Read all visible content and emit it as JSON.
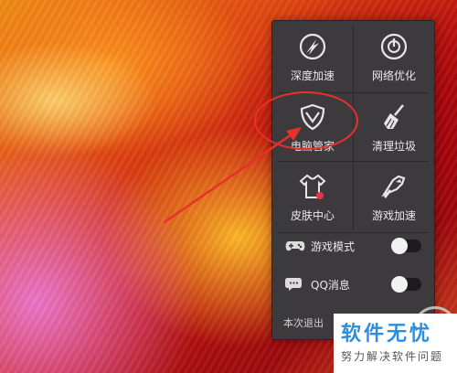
{
  "panel": {
    "tiles": [
      {
        "label": "深度加速",
        "icon": "speed-boost-icon"
      },
      {
        "label": "网络优化",
        "icon": "network-gauge-icon"
      },
      {
        "label": "电脑管家",
        "icon": "shield-icon"
      },
      {
        "label": "清理垃圾",
        "icon": "broom-icon"
      },
      {
        "label": "皮肤中心",
        "icon": "tshirt-icon"
      },
      {
        "label": "游戏加速",
        "icon": "game-boost-icon"
      }
    ],
    "toggles": [
      {
        "label": "游戏模式",
        "icon": "gamepad-icon",
        "on": false
      },
      {
        "label": "QQ消息",
        "icon": "chat-bubble-icon",
        "on": false
      }
    ],
    "exit_label": "本次退出"
  },
  "watermark": {
    "title": "软件无忧",
    "subtitle": "努力解决软件问题"
  },
  "colors": {
    "panel_bg": "#3d3a3d",
    "annotation_red": "#e8302c",
    "watermark_blue": "#2a8fe0",
    "notification_dot": "#e8334a"
  }
}
